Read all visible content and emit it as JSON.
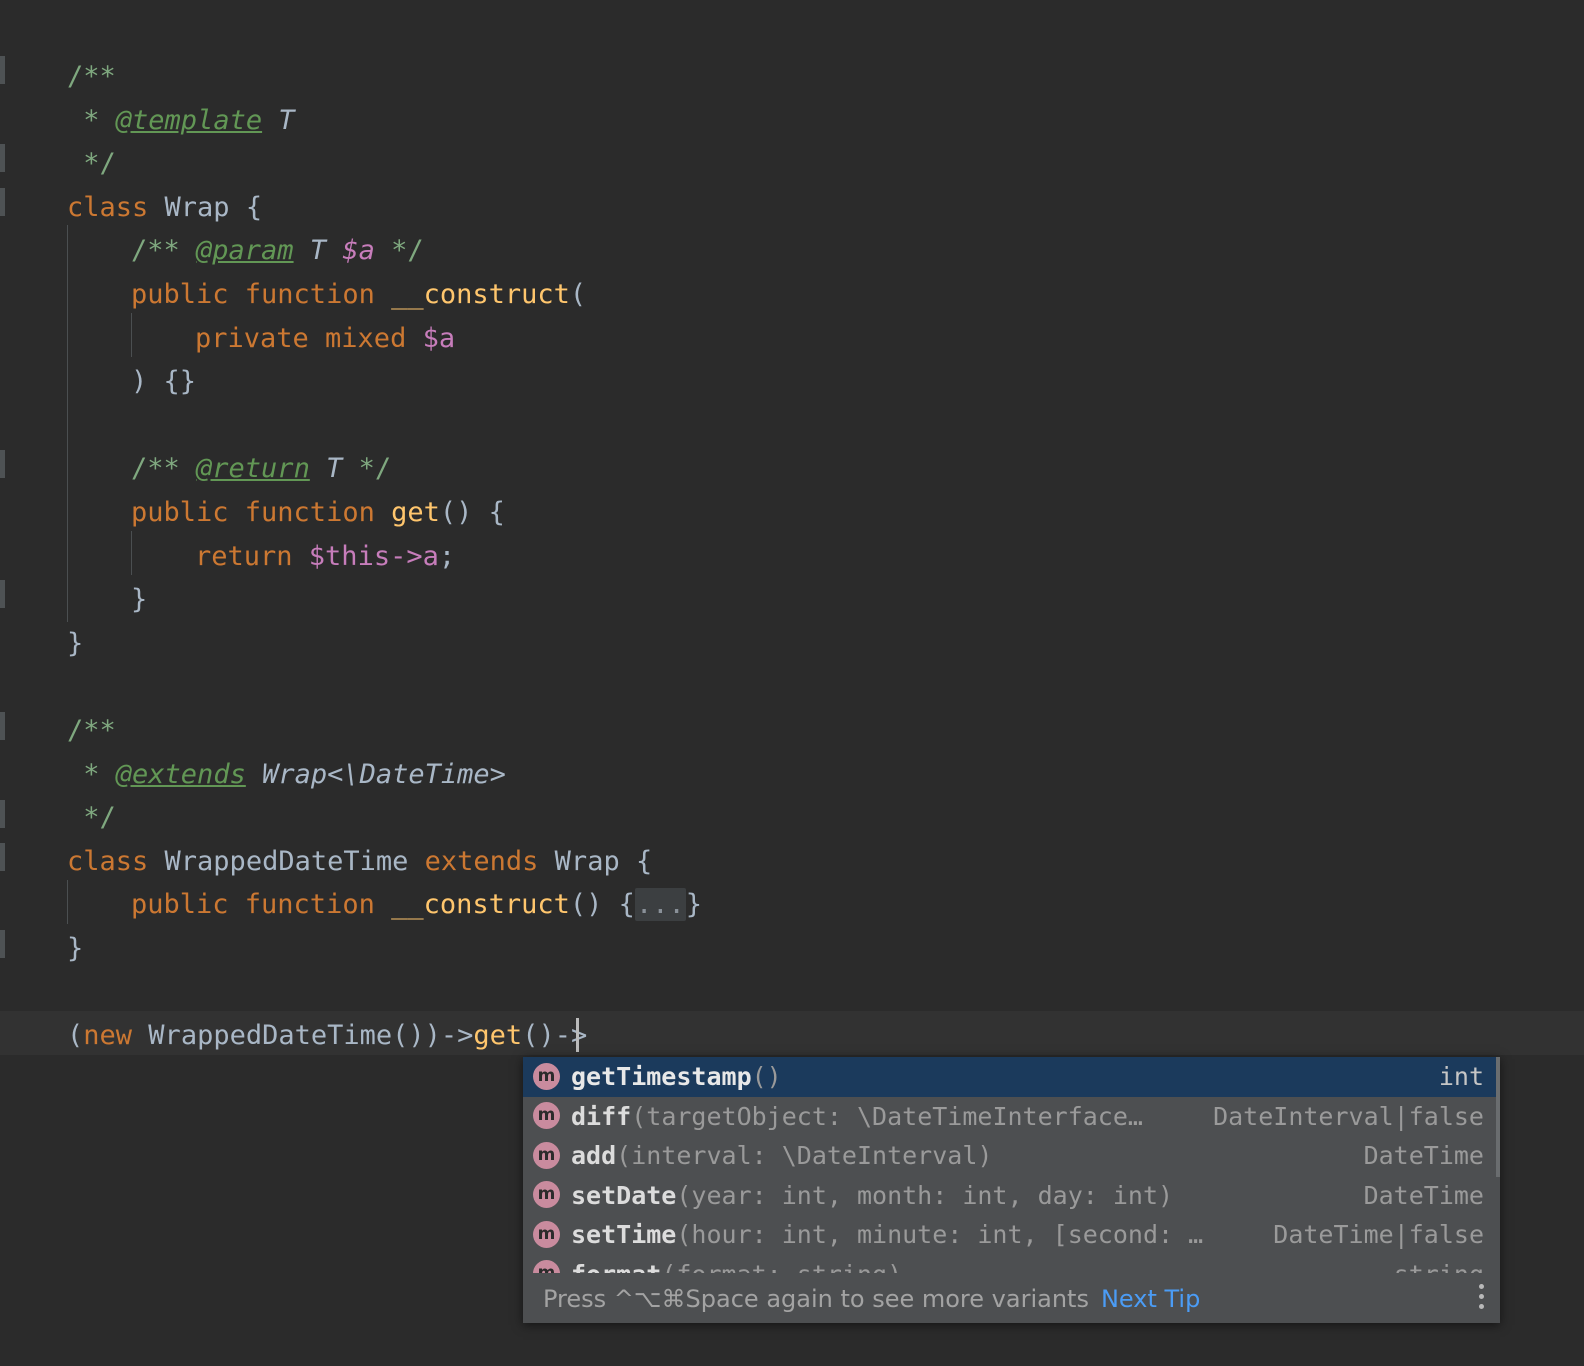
{
  "theme": {
    "editor_bg": "#2b2b2b",
    "current_line_bg": "#323232",
    "default_text": "#a9b7c6",
    "comment": "#7fa87f",
    "doc_tag": "#629755",
    "keyword": "#cc7832",
    "function": "#ffc66d",
    "variable": "#c77dbb",
    "popup_bg": "#4d4f51",
    "popup_selected_bg": "#1b3a5c",
    "link_blue": "#4b9cf5",
    "method_icon_bg": "#c98b9e"
  },
  "editor": {
    "language": "PHP",
    "code_lines": [
      {
        "indent": 0,
        "tokens": [
          {
            "t": "comment",
            "v": "/**"
          }
        ]
      },
      {
        "indent": 0,
        "tokens": [
          {
            "t": "comment",
            "v": " * "
          },
          {
            "t": "tag",
            "v": "@template"
          },
          {
            "t": "doc-ital",
            "v": " T"
          }
        ]
      },
      {
        "indent": 0,
        "tokens": [
          {
            "t": "comment",
            "v": " */"
          }
        ]
      },
      {
        "indent": 0,
        "tokens": [
          {
            "t": "kw",
            "v": "class"
          },
          {
            "t": "ident",
            "v": " Wrap {"
          }
        ]
      },
      {
        "indent": 1,
        "tokens": [
          {
            "t": "comment",
            "v": "/** "
          },
          {
            "t": "tag",
            "v": "@param"
          },
          {
            "t": "doc-ital",
            "v": " T "
          },
          {
            "t": "var-ital",
            "v": "$a"
          },
          {
            "t": "comment",
            "v": " */"
          }
        ]
      },
      {
        "indent": 1,
        "tokens": [
          {
            "t": "kw",
            "v": "public function "
          },
          {
            "t": "fn",
            "v": "__construct"
          },
          {
            "t": "punc",
            "v": "("
          }
        ]
      },
      {
        "indent": 2,
        "tokens": [
          {
            "t": "kw",
            "v": "private mixed "
          },
          {
            "t": "var",
            "v": "$a"
          }
        ]
      },
      {
        "indent": 1,
        "tokens": [
          {
            "t": "punc",
            "v": ") {}"
          }
        ]
      },
      {
        "indent": 0,
        "tokens": []
      },
      {
        "indent": 1,
        "tokens": [
          {
            "t": "comment",
            "v": "/** "
          },
          {
            "t": "tag",
            "v": "@return"
          },
          {
            "t": "doc-ital",
            "v": " T "
          },
          {
            "t": "comment",
            "v": "*/"
          }
        ]
      },
      {
        "indent": 1,
        "tokens": [
          {
            "t": "kw",
            "v": "public function "
          },
          {
            "t": "fn",
            "v": "get"
          },
          {
            "t": "punc",
            "v": "() {"
          }
        ]
      },
      {
        "indent": 2,
        "tokens": [
          {
            "t": "kw",
            "v": "return "
          },
          {
            "t": "var",
            "v": "$this->a"
          },
          {
            "t": "punc",
            "v": ";"
          }
        ]
      },
      {
        "indent": 1,
        "tokens": [
          {
            "t": "punc",
            "v": "}"
          }
        ]
      },
      {
        "indent": 0,
        "tokens": [
          {
            "t": "punc",
            "v": "}"
          }
        ]
      },
      {
        "indent": 0,
        "tokens": []
      },
      {
        "indent": 0,
        "tokens": [
          {
            "t": "comment",
            "v": "/**"
          }
        ]
      },
      {
        "indent": 0,
        "tokens": [
          {
            "t": "comment",
            "v": " * "
          },
          {
            "t": "tag",
            "v": "@extends"
          },
          {
            "t": "doc-ital",
            "v": " Wrap<\\DateTime>"
          }
        ]
      },
      {
        "indent": 0,
        "tokens": [
          {
            "t": "comment",
            "v": " */"
          }
        ]
      },
      {
        "indent": 0,
        "tokens": [
          {
            "t": "kw",
            "v": "class"
          },
          {
            "t": "ident",
            "v": " WrappedDateTime "
          },
          {
            "t": "kw",
            "v": "extends"
          },
          {
            "t": "ident",
            "v": " Wrap {"
          }
        ]
      },
      {
        "indent": 1,
        "tokens": [
          {
            "t": "kw",
            "v": "public function "
          },
          {
            "t": "fn",
            "v": "__construct"
          },
          {
            "t": "punc",
            "v": "() {"
          },
          {
            "t": "fold",
            "v": "..."
          },
          {
            "t": "punc",
            "v": "}"
          }
        ]
      },
      {
        "indent": 0,
        "tokens": [
          {
            "t": "punc",
            "v": "}"
          }
        ]
      },
      {
        "indent": 0,
        "tokens": []
      },
      {
        "indent": 0,
        "tokens": [
          {
            "t": "punc",
            "v": "("
          },
          {
            "t": "kw",
            "v": "new"
          },
          {
            "t": "ident",
            "v": " WrappedDateTime())->"
          },
          {
            "t": "fn",
            "v": "get"
          },
          {
            "t": "punc",
            "v": "()->"
          }
        ]
      }
    ],
    "current_line_text": "(new WrappedDateTime())->get()->"
  },
  "completion_popup": {
    "items": [
      {
        "icon": "m",
        "icon_name": "method-icon",
        "name": "getTimestamp",
        "params": "()",
        "type": "int",
        "selected": true
      },
      {
        "icon": "m",
        "icon_name": "method-icon",
        "name": "diff",
        "params": "(targetObject: \\DateTimeInterface…",
        "type": "DateInterval|false",
        "selected": false
      },
      {
        "icon": "m",
        "icon_name": "method-icon",
        "name": "add",
        "params": "(interval: \\DateInterval)",
        "type": "DateTime",
        "selected": false
      },
      {
        "icon": "m",
        "icon_name": "method-icon",
        "name": "setDate",
        "params": "(year: int, month: int, day: int)",
        "type": "DateTime",
        "selected": false
      },
      {
        "icon": "m",
        "icon_name": "method-icon",
        "name": "setTime",
        "params": "(hour: int, minute: int, [second: …",
        "type": "DateTime|false",
        "selected": false
      },
      {
        "icon": "m",
        "icon_name": "method-icon",
        "name": "format",
        "params": "(format: string)",
        "type": "string",
        "selected": false
      }
    ],
    "status_hint": "Press ^⌥⌘Space again to see more variants",
    "status_link": "Next Tip",
    "more_options_icon": "kebab-menu-icon"
  }
}
